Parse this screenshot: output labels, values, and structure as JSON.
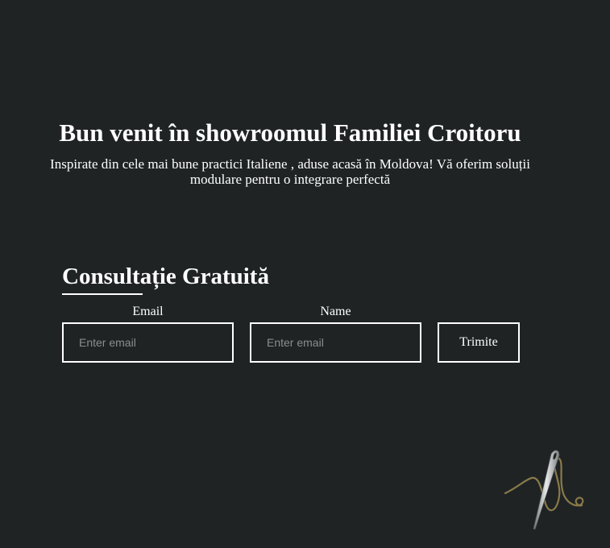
{
  "hero": {
    "title": "Bun venit în showroomul Familiei Croitoru",
    "subtitle": "Inspirate din cele mai bune practici Italiene , aduse acasă în Moldova! Vă oferim soluții modulare pentru o integrare perfectă"
  },
  "consult": {
    "title": "Consultație Gratuită"
  },
  "form": {
    "email_label": "Email",
    "email_placeholder": "Enter email",
    "email_value": "",
    "name_label": "Name",
    "name_placeholder": "Enter email",
    "name_value": "",
    "submit_label": "Trimite"
  },
  "icons": {
    "decoration": "needle-and-thread-icon"
  },
  "colors": {
    "background": "#1f2324",
    "text": "#ffffff",
    "placeholder": "#8a8e8f",
    "thread": "#8a7a4a"
  }
}
